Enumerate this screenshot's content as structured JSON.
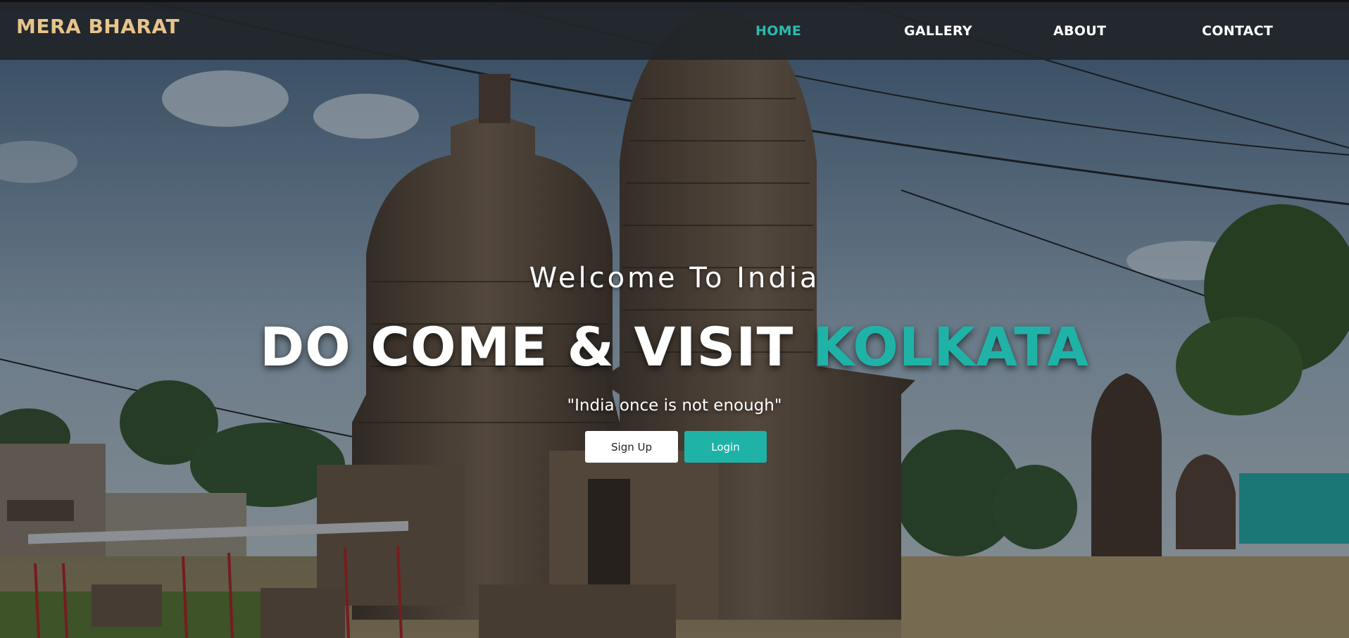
{
  "navbar": {
    "brand": "MERA BHARAT",
    "links": [
      {
        "label": "HOME",
        "active": true
      },
      {
        "label": "GALLERY",
        "active": false
      },
      {
        "label": "ABOUT",
        "active": false
      },
      {
        "label": "CONTACT",
        "active": false
      }
    ]
  },
  "hero": {
    "welcome": "Welcome To India",
    "headline_main": "DO COME & VISIT",
    "headline_accent": "KOLKATA",
    "tagline": "\"India once is not enough\"",
    "signup_label": "Sign Up",
    "login_label": "Login"
  },
  "colors": {
    "accent": "#1fb3a8",
    "brand": "#e8c48a",
    "navbar_bg": "#212529"
  }
}
